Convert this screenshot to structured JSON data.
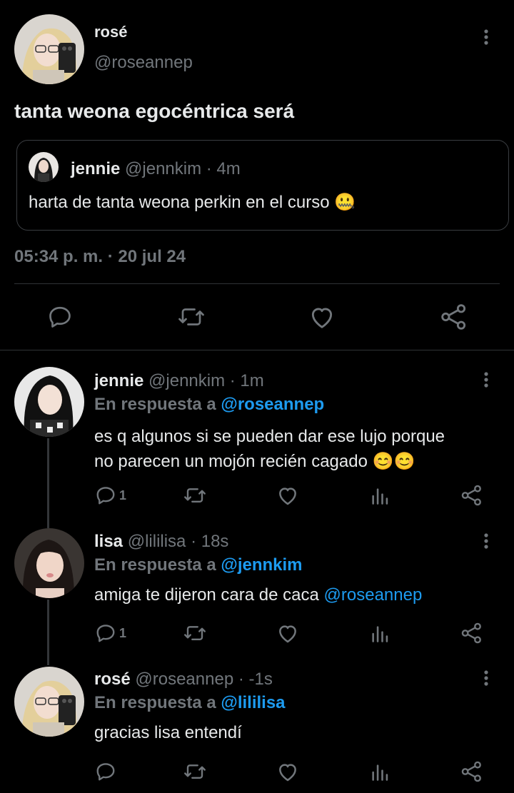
{
  "main_tweet": {
    "author_name": "rosé",
    "author_handle": "@roseannep",
    "text": "tanta weona egocéntrica será",
    "quote": {
      "author_name": "jennie",
      "author_handle": "@jennkim",
      "time": "· 4m",
      "text": "harta de tanta weona perkin en el curso",
      "emoji": "🤐"
    },
    "timestamp": "05:34 p. m. · 20 jul 24",
    "icons": [
      "reply-icon",
      "retweet-icon",
      "like-icon",
      "share-icon"
    ]
  },
  "replies": [
    {
      "author_name": "jennie",
      "author_handle": "@jennkim",
      "time": "· 1m",
      "reply_prefix": "En respuesta a",
      "reply_to": "@roseannep",
      "text_line1": "es q algunos si se pueden dar ese lujo porque",
      "text_line2": "no parecen un mojón recién cagado",
      "emoji": "😊😊",
      "reply_count": "1"
    },
    {
      "author_name": "lisa",
      "author_handle": "@lililisa",
      "time": "· 18s",
      "reply_prefix": "En respuesta a",
      "reply_to": "@jennkim",
      "text": "amiga te dijeron cara de caca",
      "mention": "@roseannep",
      "reply_count": "1"
    },
    {
      "author_name": "rosé",
      "author_handle": "@roseannep",
      "time": "· -1s",
      "reply_prefix": "En respuesta a",
      "reply_to": "@lililisa",
      "text": "gracias lisa entendí",
      "reply_count": ""
    }
  ],
  "colors": {
    "background": "#000000",
    "text": "#e7e9ea",
    "muted": "#71767b",
    "link": "#1d9bf0",
    "divider": "#2f3336"
  }
}
